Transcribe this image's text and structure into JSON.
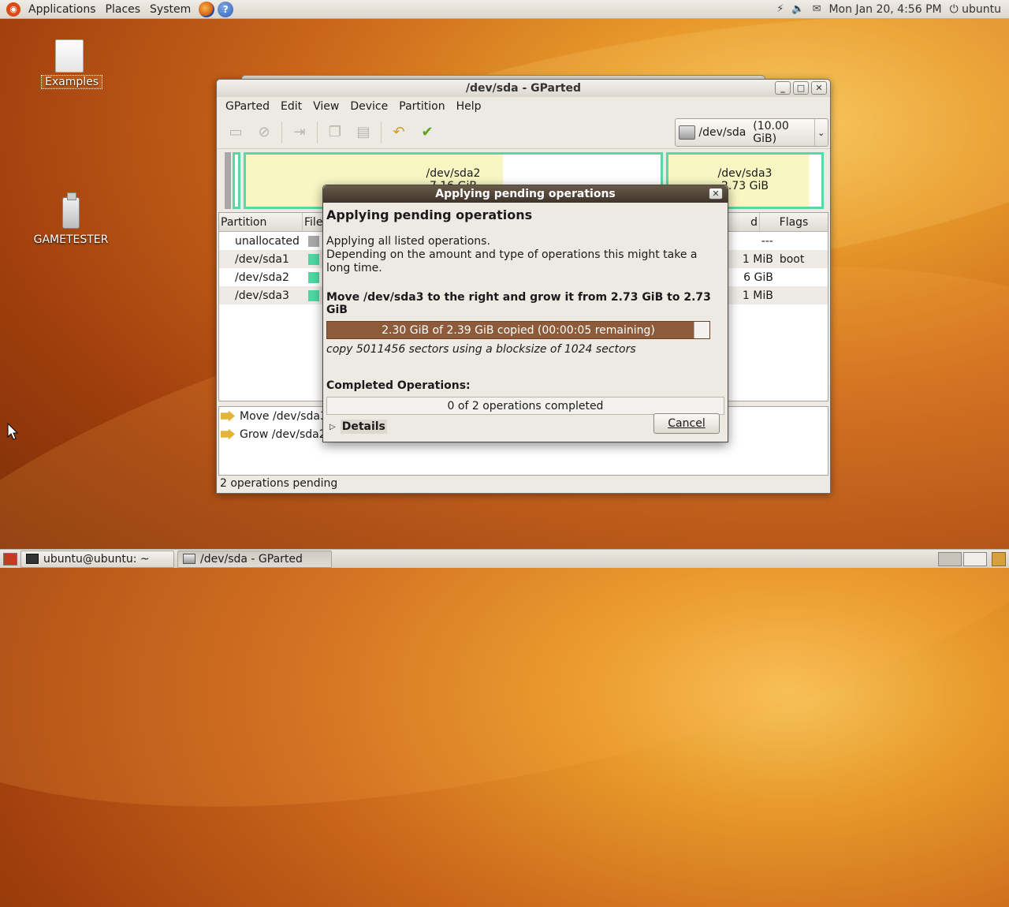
{
  "top_panel": {
    "applications": "Applications",
    "places": "Places",
    "system": "System",
    "datetime": "Mon Jan 20,  4:56 PM",
    "user": "ubuntu"
  },
  "desktop": {
    "examples": "Examples",
    "gametester": "GAMETESTER"
  },
  "window": {
    "title": "/dev/sda - GParted",
    "menu": [
      "GParted",
      "Edit",
      "View",
      "Device",
      "Partition",
      "Help"
    ],
    "device": "/dev/sda",
    "device_size": "(10.00 GiB)",
    "disk_map": {
      "sda2_name": "/dev/sda2",
      "sda2_size": "7.16 GiB",
      "sda3_name": "/dev/sda3",
      "sda3_size": "2.73 GiB"
    },
    "columns": {
      "partition": "Partition",
      "filesystem": "File",
      "used": "d",
      "flags": "Flags"
    },
    "rows": [
      {
        "partition": "unallocated",
        "fs_initial": "u",
        "used": "---",
        "flags": "",
        "color": "#a8a8a8"
      },
      {
        "partition": "/dev/sda1",
        "fs_initial": "r",
        "used": "1 MiB",
        "flags": "boot",
        "color": "#4fd6a3"
      },
      {
        "partition": "/dev/sda2",
        "fs_initial": "r",
        "used": "6 GiB",
        "flags": "",
        "color": "#4fd6a3"
      },
      {
        "partition": "/dev/sda3",
        "fs_initial": "r",
        "used": "1 MiB",
        "flags": "",
        "color": "#4fd6a3"
      }
    ],
    "operations": [
      {
        "text": "Move /dev/sda3 t"
      },
      {
        "text": "Grow /dev/sda2 f"
      }
    ],
    "status": "2 operations pending"
  },
  "dialog": {
    "title": "Applying pending operations",
    "heading": "Applying pending operations",
    "text1": "Applying all listed operations.",
    "text2": "Depending on the amount and type of operations this might take a long time.",
    "current_op": "Move /dev/sda3 to the right and grow it from 2.73 GiB to 2.73 GiB",
    "progress_text": "2.30 GiB of 2.39 GiB copied (00:00:05 remaining)",
    "progress_fraction": 0.96,
    "detail_line": "copy 5011456 sectors using a blocksize of 1024 sectors",
    "completed_label": "Completed Operations:",
    "completed_text": "0 of 2 operations completed",
    "details_label": "Details",
    "cancel_label": "Cancel"
  },
  "taskbar": {
    "terminal": "ubuntu@ubuntu: ~",
    "gparted": "/dev/sda - GParted"
  }
}
